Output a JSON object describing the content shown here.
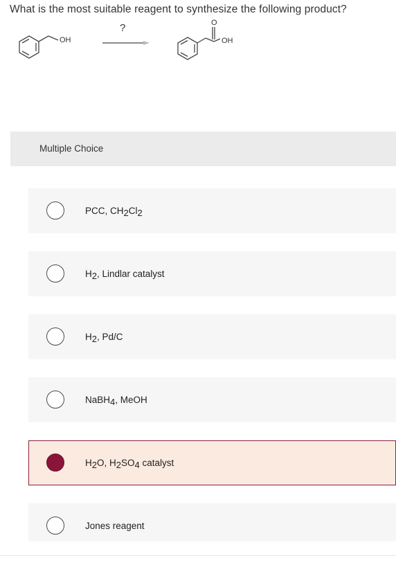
{
  "question": {
    "text": "What is the most suitable reagent to synthesize the following product?"
  },
  "reaction": {
    "reagent_placeholder": "?",
    "reactant_group": "OH",
    "product_carbonyl_o": "O",
    "product_group": "OH"
  },
  "multiple_choice": {
    "header": "Multiple Choice",
    "selected_index": 4,
    "options": [
      {
        "parts": [
          {
            "t": "PCC, CH"
          },
          {
            "s": "2"
          },
          {
            "t": "Cl"
          },
          {
            "s": "2"
          }
        ]
      },
      {
        "parts": [
          {
            "t": "H"
          },
          {
            "s": "2"
          },
          {
            "t": ", Lindlar catalyst"
          }
        ]
      },
      {
        "parts": [
          {
            "t": "H"
          },
          {
            "s": "2"
          },
          {
            "t": ", Pd/C"
          }
        ]
      },
      {
        "parts": [
          {
            "t": "NaBH"
          },
          {
            "s": "4"
          },
          {
            "t": ", MeOH"
          }
        ]
      },
      {
        "parts": [
          {
            "t": "H"
          },
          {
            "s": "2"
          },
          {
            "t": "O, H"
          },
          {
            "s": "2"
          },
          {
            "t": "SO"
          },
          {
            "s": "4"
          },
          {
            "t": " catalyst"
          }
        ]
      },
      {
        "parts": [
          {
            "t": "Jones reagent"
          }
        ]
      }
    ]
  },
  "colors": {
    "selected_fill": "#8a1538",
    "selected_bg": "#fbeae0",
    "selected_border": "#8a1f3c",
    "option_bg": "#f6f6f6",
    "header_bg": "#ebebeb"
  }
}
